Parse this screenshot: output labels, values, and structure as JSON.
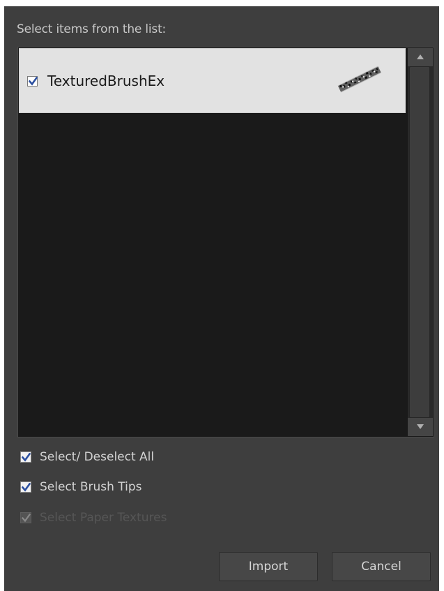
{
  "dialog": {
    "prompt": "Select items from the list:"
  },
  "list": {
    "items": [
      {
        "label": "TexturedBrushEx",
        "checked": true,
        "preview_icon": "textured-brush-stroke"
      }
    ]
  },
  "options": {
    "select_all": {
      "label": "Select/ Deselect All",
      "checked": true,
      "enabled": true
    },
    "brush_tips": {
      "label": "Select Brush Tips",
      "checked": true,
      "enabled": true
    },
    "paper_textures": {
      "label": "Select Paper Textures",
      "checked": true,
      "enabled": false
    }
  },
  "buttons": {
    "import": "Import",
    "cancel": "Cancel"
  },
  "colors": {
    "dialog_bg": "#3e3e3e",
    "list_bg": "#1a1a1a",
    "item_bg": "#e2e2e2",
    "check_blue": "#2b4fa0"
  }
}
